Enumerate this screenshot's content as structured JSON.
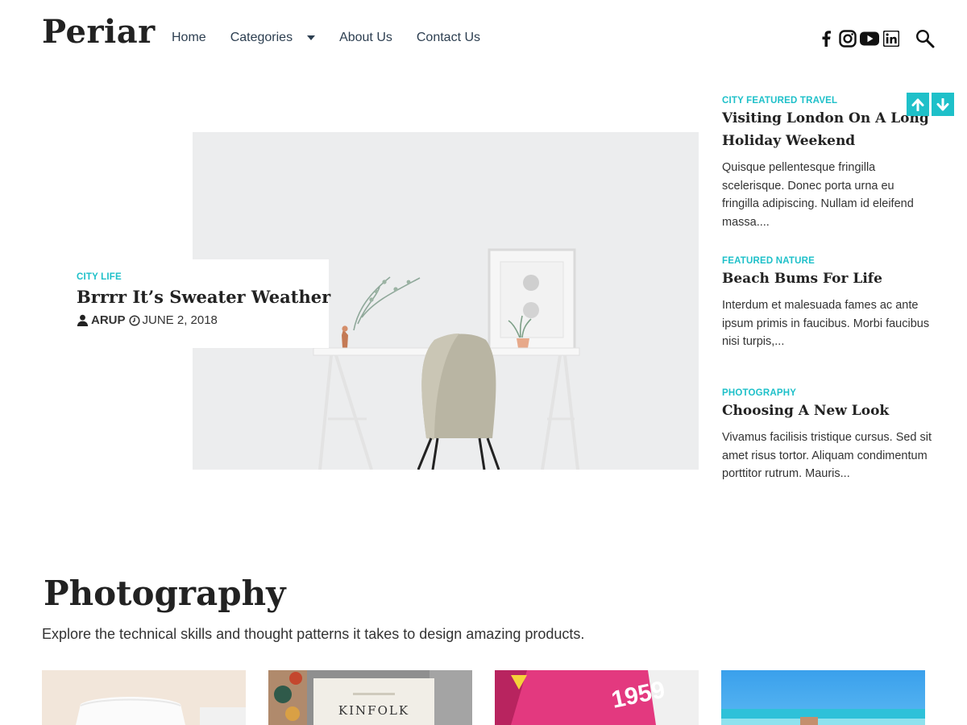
{
  "header": {
    "logo": "Periar",
    "nav": [
      {
        "label": "Home"
      },
      {
        "label": "Categories"
      },
      {
        "label": "About Us"
      },
      {
        "label": "Contact Us"
      }
    ],
    "social_icons": [
      "facebook-icon",
      "instagram-icon",
      "youtube-icon",
      "linkedin-icon"
    ],
    "search_icon": "search-icon"
  },
  "hero": {
    "category": "CITY LIFE",
    "title": "Brrrr It’s Sweater Weather",
    "author": "ARUP",
    "date": "JUNE 2, 2018"
  },
  "side_posts": [
    {
      "categories": "CITY FEATURED TRAVEL",
      "title": "Visiting London On A Long Holiday Weekend",
      "excerpt": "Quisque pellentesque fringilla scelerisque. Donec porta urna eu fringilla adipiscing. Nullam id eleifend massa...."
    },
    {
      "categories": "FEATURED NATURE",
      "title": "Beach Bums For Life",
      "excerpt": "Interdum et malesuada fames ac ante ipsum primis in faucibus. Morbi faucibus nisi turpis,..."
    },
    {
      "categories": "PHOTOGRAPHY",
      "title": "Choosing A New Look",
      "excerpt": "Vivamus facilisis tristique cursus. Sed sit amet risus tortor. Aliquam condimentum porttitor rutrum. Mauris..."
    }
  ],
  "section": {
    "title": "Photography",
    "description": "Explore the technical skills and thought patterns it takes to design amazing products."
  },
  "thumb_text": {
    "kinfolk": "KINFOLK",
    "magazine": "1959"
  },
  "colors": {
    "accent": "#1ec0c9",
    "highlight": "#7ff1f3",
    "text_dark": "#222222"
  }
}
